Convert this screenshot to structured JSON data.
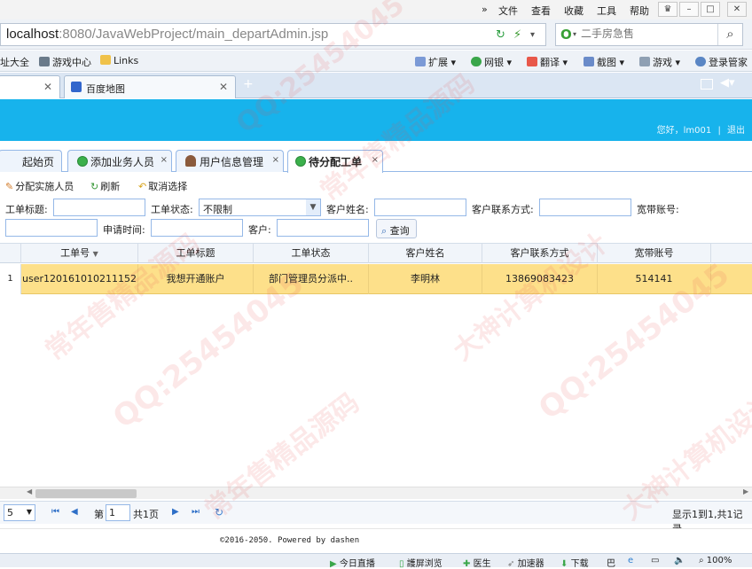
{
  "browser": {
    "menu": [
      "»",
      "文件",
      "查看",
      "收藏",
      "工具",
      "帮助"
    ],
    "address": {
      "host": "localhost",
      "rest": ":8080/JavaWebProject/main_departAdmin.jsp"
    },
    "search_placeholder": "二手房急售",
    "favorites": [
      "址大全",
      "游戏中心",
      "Links"
    ],
    "right_tools": [
      "扩展",
      "网银",
      "翻译",
      "截图",
      "游戏",
      "登录管家"
    ],
    "tabs": [
      {
        "label": "",
        "closable": true
      },
      {
        "label": "百度地图",
        "closable": true
      }
    ],
    "new_tab": "+"
  },
  "app": {
    "user_greeting": "您好，lm001",
    "logout": "退出",
    "tabs": [
      {
        "label": "起始页",
        "icon": ""
      },
      {
        "label": "添加业务人员",
        "icon": "add-icon"
      },
      {
        "label": "用户信息管理",
        "icon": "user-icon"
      },
      {
        "label": "待分配工单",
        "icon": "add-icon"
      }
    ],
    "toolbar": {
      "assign": "分配实施人员",
      "refresh": "刷新",
      "cancel": "取消选择"
    },
    "filters": {
      "title_label": "工单标题:",
      "status_label": "工单状态:",
      "status_value": "不限制",
      "customer_label": "客户姓名:",
      "contact_label": "客户联系方式:",
      "account_label": "宽带账号:",
      "apply_time_label": "申请时间:",
      "customer2_label": "客户:",
      "query": "查询"
    },
    "grid": {
      "columns": [
        "工单号",
        "工单标题",
        "工单状态",
        "客户姓名",
        "客户联系方式",
        "宽带账号"
      ],
      "rows": [
        {
          "num": "1",
          "cells": [
            "user120161010211152",
            "我想开通账户",
            "部门管理员分派中..",
            "李明林",
            "13869083423",
            "514141"
          ]
        }
      ]
    },
    "pager": {
      "page_size": "5",
      "page_label": "第",
      "page_value": "1",
      "total_pages": "共1页",
      "summary": "显示1到1,共1记录"
    },
    "footer": "©2016-2050. Powered by dashen"
  },
  "statusbar": [
    "今日直播",
    "護屏浏览",
    "医生",
    "加速器",
    "下载",
    "100%"
  ],
  "watermarks": [
    "QQ:25454045",
    "常年售精品源码",
    "大神计算机设计"
  ]
}
